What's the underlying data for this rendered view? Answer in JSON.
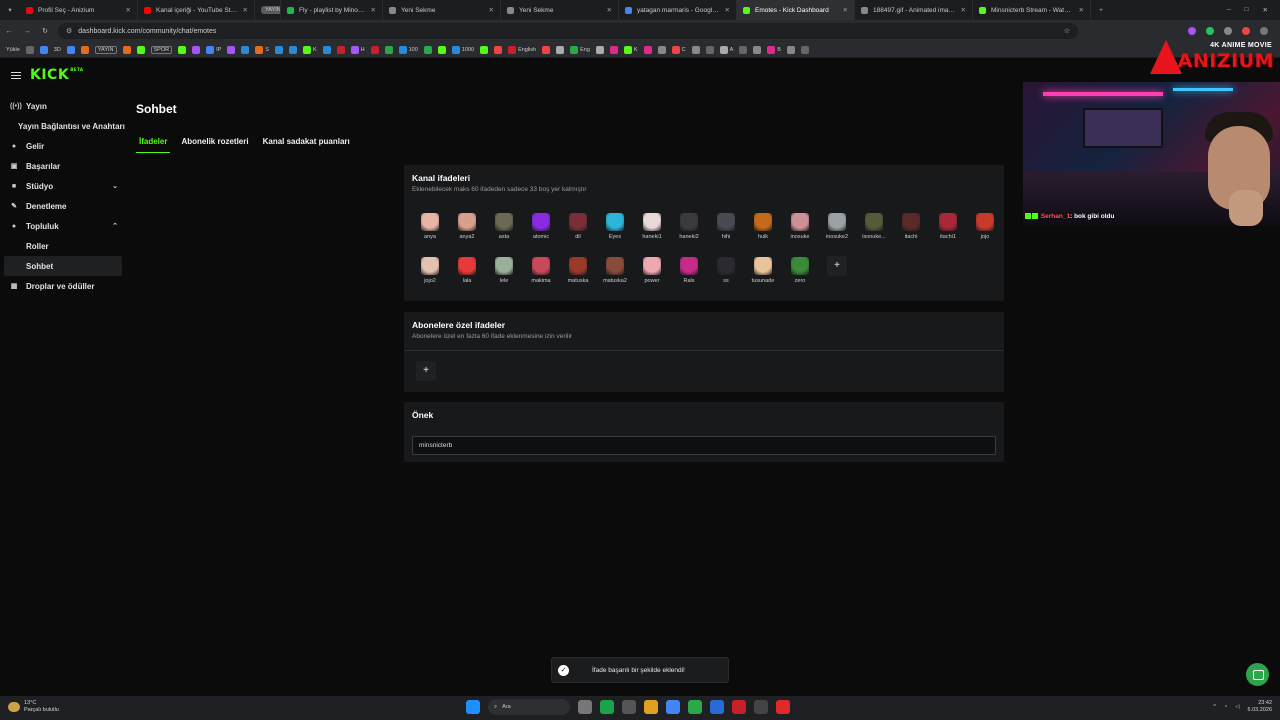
{
  "browser": {
    "tabs": [
      {
        "title": "Profil Seç - Anizium",
        "color": "#e50914",
        "width": 118
      },
      {
        "title": "Kanal içeriği - YouTube Studio",
        "color": "#ff0000",
        "width": 117
      },
      {
        "title": "YAYIN",
        "pill": true,
        "width": 26
      },
      {
        "title": "Fly - playlist by Minonicterb",
        "color": "#1db954",
        "width": 102
      },
      {
        "title": "Yeni Sekme",
        "color": "#888888",
        "width": 118
      },
      {
        "title": "Yeni Sekme",
        "color": "#888888",
        "width": 118
      },
      {
        "title": "yatagan marmaris - Google'da",
        "color": "#4285f4",
        "width": 118
      },
      {
        "title": "Emotes - Kick Dashboard",
        "color": "#53fc18",
        "width": 118,
        "active": true
      },
      {
        "title": "188497.gif - Animated image",
        "color": "#888888",
        "width": 118
      },
      {
        "title": "Minsnicterb Stream - Watch Li",
        "color": "#53fc18",
        "width": 118
      }
    ],
    "url": "dashboard.kick.com/community/chat/emotes",
    "bookmarks": [
      "Yükle",
      "3D",
      "YAYIN",
      "SPOR",
      "IP",
      "S",
      "K",
      "H",
      "100",
      "1000",
      "English",
      "Eng",
      "K",
      "C",
      "A",
      "B"
    ]
  },
  "brand": {
    "line1": "4K ANIME MOVIE",
    "line2": "ANIZIUM"
  },
  "webcam_chat": {
    "user": "Serhan_1",
    "message": ": bok gibi oldu"
  },
  "sidebar": {
    "items": [
      {
        "label": "Yayın",
        "icon": "broadcast-icon",
        "glyph": "((•))"
      },
      {
        "label": "Yayın Bağlantısı ve Anahtarı",
        "indent": true
      },
      {
        "label": "Gelir",
        "icon": "coin-icon",
        "glyph": "●"
      },
      {
        "label": "Başarılar",
        "icon": "trophy-icon",
        "glyph": "▣"
      },
      {
        "label": "Stüdyo",
        "icon": "studio-icon",
        "glyph": "■",
        "chevron": "down"
      },
      {
        "label": "Denetleme",
        "icon": "wrench-icon",
        "glyph": "✎"
      },
      {
        "label": "Topluluk",
        "icon": "people-icon",
        "glyph": "●",
        "chevron": "up"
      },
      {
        "label": "Roller",
        "sub": true
      },
      {
        "label": "Sohbet",
        "sub": true,
        "active": true
      },
      {
        "label": "Droplar ve ödüller",
        "icon": "gift-icon",
        "glyph": "▦"
      }
    ]
  },
  "page": {
    "title": "Sohbet",
    "tabs": [
      {
        "label": "İfadeler",
        "active": true
      },
      {
        "label": "Abonelik rozetleri"
      },
      {
        "label": "Kanal sadakat puanları"
      }
    ]
  },
  "channel_emotes": {
    "title": "Kanal ifadeleri",
    "subtitle": "Eklenebilecek maks 60 ifadeden sadece 33 boş yer kalmıştır",
    "items": [
      {
        "name": "anya",
        "color": "#e8b4a8"
      },
      {
        "name": "anya2",
        "color": "#d8a08c"
      },
      {
        "name": "asta",
        "color": "#6b6a55"
      },
      {
        "name": "atomic",
        "color": "#8a2be2"
      },
      {
        "name": "dil",
        "color": "#7a2e3a"
      },
      {
        "name": "Eyes",
        "color": "#2bb5d8"
      },
      {
        "name": "haneki1",
        "color": "#e9d8d8"
      },
      {
        "name": "haneki2",
        "color": "#3a3a40"
      },
      {
        "name": "hihi",
        "color": "#4a4a55"
      },
      {
        "name": "hulk",
        "color": "#c46a1a"
      },
      {
        "name": "inosuke",
        "color": "#cf8f96"
      },
      {
        "name": "inosuke2",
        "color": "#9aa0a4"
      },
      {
        "name": "isonuke...",
        "color": "#555a3a"
      },
      {
        "name": "itachi",
        "color": "#5a2a2a"
      },
      {
        "name": "itachi1",
        "color": "#a8283a"
      },
      {
        "name": "jojo",
        "color": "#c83a2a"
      },
      {
        "name": "jojo2",
        "color": "#e6c0b0"
      },
      {
        "name": "lala",
        "color": "#e63a3a"
      },
      {
        "name": "lele",
        "color": "#9ab09a"
      },
      {
        "name": "makima",
        "color": "#c84a5a"
      },
      {
        "name": "matuska",
        "color": "#9a3a2a"
      },
      {
        "name": "matuska2",
        "color": "#8a4a3a"
      },
      {
        "name": "power",
        "color": "#f0a8b0"
      },
      {
        "name": "Rals",
        "color": "#c82a8a"
      },
      {
        "name": "ss",
        "color": "#2a2a30"
      },
      {
        "name": "tusunade",
        "color": "#e8c49a"
      },
      {
        "name": "zero",
        "color": "#3a8a3a"
      }
    ],
    "add_label": "+"
  },
  "subscriber_emotes": {
    "title": "Abonelere özel ifadeler",
    "subtitle": "Abonelere özel en fazla 60 ifade eklenmesine izin verilir",
    "add_label": "+"
  },
  "preview": {
    "title": "Önek",
    "value": "minsnicterb"
  },
  "toast": {
    "message": "İfade başarılı bir şekilde eklendi!"
  },
  "taskbar": {
    "weather_temp": "13°C",
    "weather_text": "Parçalı bulutlu",
    "search_placeholder": "Ara",
    "time": "23:42",
    "date": "6.03.2026"
  },
  "colors": {
    "accent": "#53fc18",
    "background": "#0b0b0c",
    "panel": "#18191b"
  }
}
